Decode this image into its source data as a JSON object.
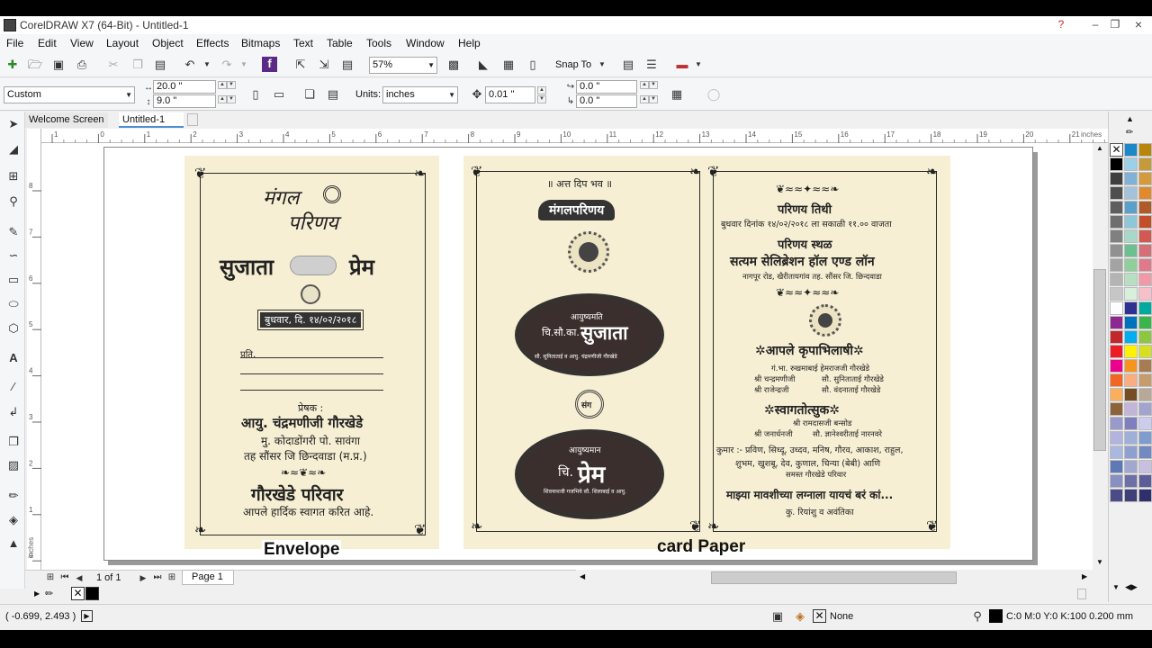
{
  "app": {
    "title": "CorelDRAW X7 (64-Bit) - Untitled-1",
    "window_buttons": [
      "?",
      "–",
      "❐",
      "×"
    ]
  },
  "menu": [
    "File",
    "Edit",
    "View",
    "Layout",
    "Object",
    "Effects",
    "Bitmaps",
    "Text",
    "Table",
    "Tools",
    "Window",
    "Help"
  ],
  "toolbar": {
    "zoom": "57%",
    "snap_to": "Snap To"
  },
  "property_bar": {
    "page_preset": "Custom",
    "width": "20.0 \"",
    "height": "9.0 \"",
    "units_label": "Units:",
    "units": "inches",
    "nudge": "0.01 \"",
    "dup_x": "0.0 \"",
    "dup_y": "0.0 \""
  },
  "tabs": [
    "Welcome Screen",
    "Untitled-1"
  ],
  "ruler": {
    "units": "inches",
    "top_ticks": [
      "1",
      "0",
      "1",
      "2",
      "3",
      "4",
      "5",
      "6",
      "7",
      "8",
      "9",
      "10",
      "11",
      "12",
      "13",
      "14",
      "15",
      "16",
      "17",
      "18",
      "19",
      "20",
      "21"
    ],
    "left_ticks": [
      "8",
      "7",
      "6",
      "5",
      "4",
      "3",
      "2",
      "1",
      "0"
    ],
    "left_label": "inches"
  },
  "document": {
    "envelope_caption": "Envelope",
    "card_caption": "card Paper",
    "envelope": {
      "script_title_1": "मंगल",
      "script_title_2": "परिणय",
      "bride": "सुजाता",
      "groom": "प्रेम",
      "date": "बुधवार, दि. १४/०२/२०१८",
      "to_label": "प्रति,",
      "sender_label": "प्रेषक :",
      "sender_name": "आयु. चंद्रमणीजी गौरखेडे",
      "sender_addr1": "मु. कोदाडोंगरी पो. सावंगा",
      "sender_addr2": "तह  सौंसर जि  छिन्दवाडा (म.प्र.)",
      "family": "गौरखेडे परिवार",
      "welcome": "आपले हार्दिक स्वागत करित आहे."
    },
    "card_left": {
      "top_line": "॥ अत्त दिप भव ॥",
      "banner": "मंगलपरिणय",
      "bride_prefix": "आयुष्यमति",
      "bride_title": "चि.सौ.का.",
      "bride_name": "सुजाता",
      "bride_parents": "सौ. सुनिताताई व आयु. चंद्रमणीजी गौरखेडे",
      "sang": "संग",
      "groom_prefix": "आयुष्यमान",
      "groom_title": "चि.",
      "groom_name": "प्रेम",
      "groom_parents": "शिवनाथजी गजभिये सौ. शिलाबाई व आयु."
    },
    "card_right": {
      "date_heading": "परिणय तिथी",
      "date_line": "बुधवार दिनांक १४/०२/२०१८ ला सकाळी ११.०० वाजता",
      "venue_heading": "परिणय स्थळ",
      "venue_name": "सत्यम सेलिब्रेशन हॉल एण्ड लॉन",
      "venue_addr": "नागपूर रोड, खैरीतायगांव  तह. सौंसर जि. छिन्दवाडा",
      "hosts_heading": "✲आपले कृपाभिलाषी✲",
      "hosts_1": "गं.भा. रुखमाबाई हेमराजजी गौरखेडे",
      "hosts_2a": "श्री चन्द्रमणीजी",
      "hosts_2b": "सौ. सुनिताताई गौरखेडे",
      "hosts_3a": "श्री राजेन्द्रजी",
      "hosts_3b": "सौ. वंदनाताई गौरखेडे",
      "welcomers_heading": "✲स्वागतोत्सुक✲",
      "welcomers_1": "श्री रामदासजी बन्सोड",
      "welcomers_2a": "श्री जनार्धनजी",
      "welcomers_2b": "सौ. ज्ञानेश्वरीताई नारनवरे",
      "kids_1": "कुमार :- प्रविण, सिध्दू, उध्दव, मनिष, गौरव, आकाश, राहुल,",
      "kids_2": "शुभम, खुशबू, देव, कुणाल, चिन्या (बेबी) आणि",
      "kids_3": "समस्त गौरखेडे परिवार",
      "tagline": "माझ्या मावशीच्या लग्नाला यायचं बरं कां...",
      "children": "कु. रियांशु व अवंतिका"
    }
  },
  "page_nav": {
    "page_count": "1 of 1",
    "page_tab": "Page 1"
  },
  "status": {
    "coords": "( -0.699, 2.493 )",
    "fill": "None",
    "outline": "C:0 M:0 Y:0 K:100  0.200 mm"
  },
  "palette_colors": [
    "#1a88c9",
    "#b8860b",
    "#000000",
    "#9bd0e6",
    "#c49a3a",
    "#3f3f3f",
    "#7fb2d6",
    "#d49a3b",
    "#4e4e4e",
    "#a2c3d9",
    "#e08a2c",
    "#5e5e5e",
    "#5aa0c8",
    "#b05a2a",
    "#6f6f6f",
    "#8ec8d8",
    "#c24e2a",
    "#808080",
    "#a8d8c8",
    "#d05a52",
    "#919191",
    "#6cbf8e",
    "#d66e78",
    "#a3a3a3",
    "#8fcf9c",
    "#e07a8a",
    "#b4b4b4",
    "#b8dfc4",
    "#f09aa8",
    "#c6c6c6",
    "#d8efdc",
    "#f7c0c8",
    "#ffffff",
    "#2e3192",
    "#00a99d",
    "#8e278f",
    "#0071bc",
    "#39b54a",
    "#c1272d",
    "#00aeef",
    "#8dc63f",
    "#ed1c24",
    "#fff200",
    "#d7df23",
    "#ec008c",
    "#f7941d",
    "#a67c52",
    "#f26522",
    "#f9ad81",
    "#c69c6d",
    "#fbaf5d",
    "#754c24",
    "#b8a898",
    "#8c6239",
    "#c3b5d9",
    "#a3a3cf",
    "#9999cc",
    "#7f7fbf",
    "#ccccee",
    "#b3b3dd",
    "#9fb0d8",
    "#7f9ccf",
    "#aab8e0",
    "#8ea0cf",
    "#7289c2",
    "#5f78b8",
    "#a0a8d0",
    "#c8c0e0",
    "#8890c0",
    "#6f6fa8",
    "#5c5c98",
    "#4b4b88",
    "#3f3f7a",
    "#2f2f6b"
  ]
}
